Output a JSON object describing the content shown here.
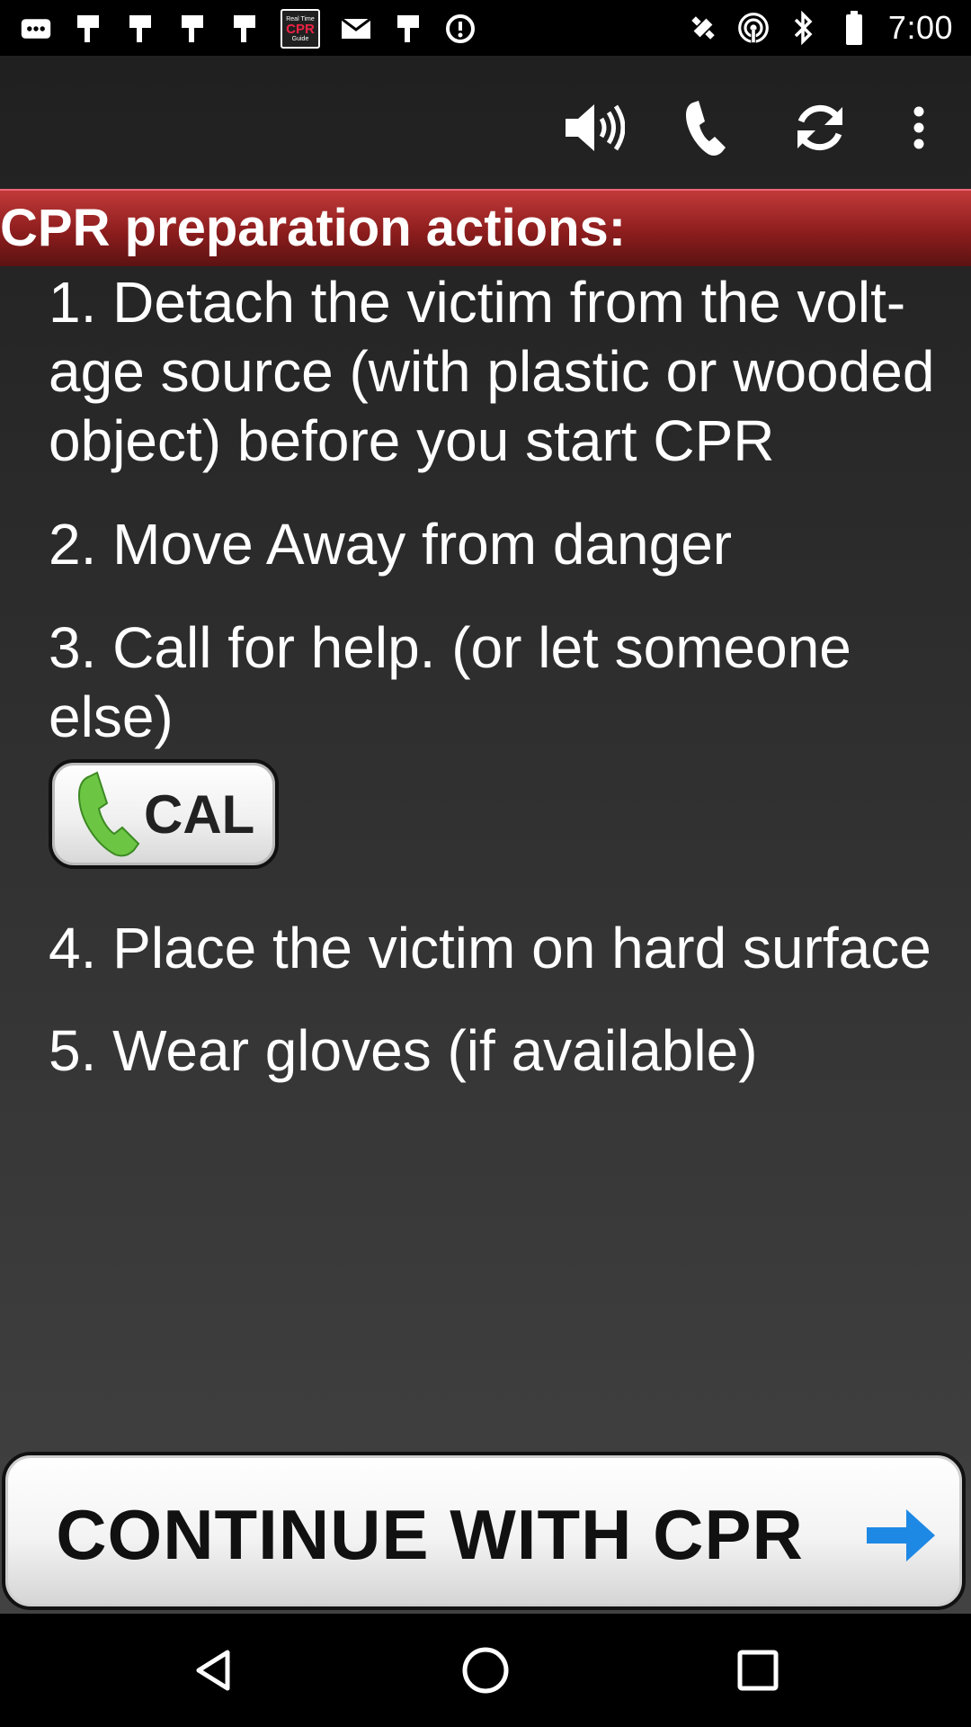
{
  "status_bar": {
    "time": "7:00",
    "app_icon": {
      "top_text": "Real Time",
      "main_text": "CPR",
      "bottom_text": "Guide"
    },
    "left_icons": [
      "message-icon",
      "notification-icon",
      "notification-icon",
      "notification-icon",
      "notification-icon",
      "cpr-app-icon",
      "email-icon",
      "notification-icon",
      "sync-icon"
    ],
    "right_icons": [
      "location-icon",
      "hotspot-icon",
      "bluetooth-icon",
      "battery-icon"
    ]
  },
  "toolbar": {
    "icons": [
      "speaker-icon",
      "phone-icon",
      "refresh-icon",
      "more-options-icon"
    ]
  },
  "header": {
    "title": "CPR preparation actions:"
  },
  "steps": [
    {
      "lines": [
        "1. Detach the victim from the volt-",
        "age source (with plastic or wooded",
        "object) before you start CPR"
      ]
    },
    {
      "lines": [
        "2. Move Away from danger"
      ]
    },
    {
      "lines": [
        "3. Call for help. (or let someone",
        "else)"
      ]
    },
    {
      "lines": [
        "4. Place the victim on hard surface"
      ]
    },
    {
      "lines": [
        "5. Wear gloves (if available)"
      ]
    }
  ],
  "call_button": {
    "label": "CAL"
  },
  "continue_button": {
    "label": "CONTINUE WITH CPR"
  },
  "colors": {
    "header_red": "#8d1d1d",
    "arrow_blue": "#1e88e5",
    "phone_green": "#6cc644"
  },
  "nav_bar": {
    "icons": [
      "back-icon",
      "home-icon",
      "recents-icon"
    ]
  }
}
